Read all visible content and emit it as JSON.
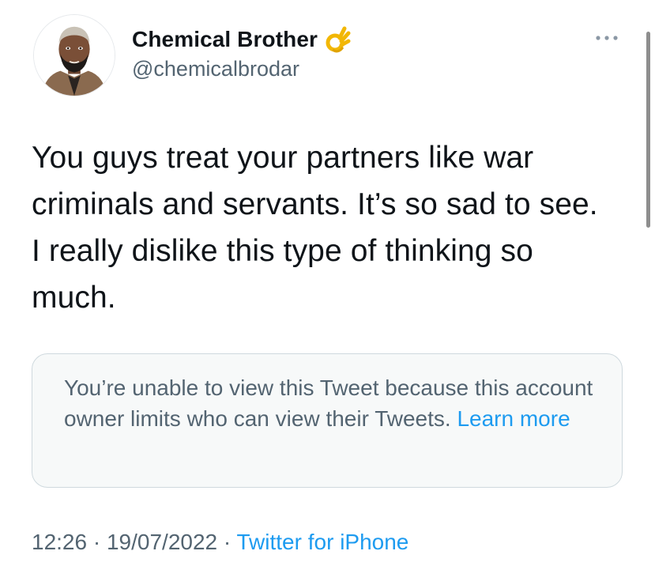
{
  "author": {
    "display_name": "Chemical Brother",
    "handle": "@chemicalbrodar",
    "badge_icon": "ok-hand-emoji-icon",
    "avatar_icon": "cartoon-avatar-icon"
  },
  "more_menu": {
    "icon": "more-dots-icon"
  },
  "tweet": {
    "text": "You guys treat your partners like war criminals and servants. It’s so sad to see. I really dislike this type of thinking so much."
  },
  "quoted_notice": {
    "message": "You’re unable to view this Tweet because this account owner limits who can view their Tweets.",
    "link_label": "Learn more"
  },
  "meta": {
    "time": "12:26",
    "separator": " · ",
    "date": "19/07/2022",
    "source": "Twitter for iPhone"
  },
  "colors": {
    "text_primary": "#0f1419",
    "text_secondary": "#536471",
    "link": "#1d9bf0",
    "card_background": "#f7f9f9",
    "card_border": "#cfd9de"
  }
}
